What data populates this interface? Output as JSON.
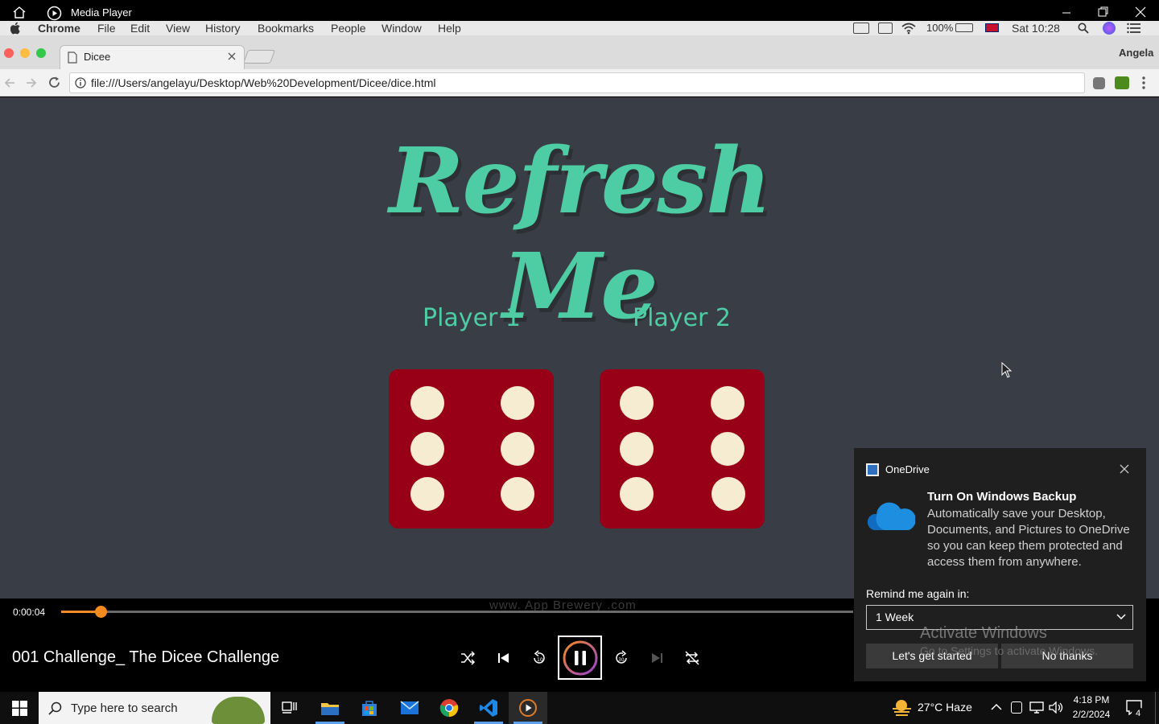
{
  "media_player": {
    "app_title": "Media Player",
    "current_time": "0:00:04",
    "progress_fraction": 0.05,
    "track_title": "001 Challenge_ The Dicee Challenge"
  },
  "mac_menu": {
    "app_name": "Chrome",
    "items": [
      "File",
      "Edit",
      "View",
      "History",
      "Bookmarks",
      "People",
      "Window",
      "Help"
    ],
    "battery": "100%",
    "clock": "Sat 10:28"
  },
  "browser": {
    "tab_title": "Dicee",
    "profile": "Angela",
    "url": "file:///Users/angelayu/Desktop/Web%20Development/Dicee/dice.html"
  },
  "page": {
    "title": "Refresh Me",
    "player1": "Player 1",
    "player2": "Player 2",
    "die1_value": 6,
    "die2_value": 6,
    "watermark": "www.  App Brewery  .com"
  },
  "onedrive": {
    "app": "OneDrive",
    "heading": "Turn On Windows Backup",
    "body": "Automatically save your Desktop, Documents, and Pictures to OneDrive so you can keep them protected and access them from anywhere.",
    "remind_label": "Remind me again in:",
    "remind_value": "1 Week",
    "primary_button": "Let's get started",
    "secondary_button": "No thanks",
    "activate_title": "Activate Windows",
    "activate_sub": "Go to Settings to activate Windows."
  },
  "taskbar": {
    "search_placeholder": "Type here to search",
    "weather": "27°C  Haze",
    "time": "4:18 PM",
    "date": "2/2/2024",
    "notifications": "4"
  },
  "colors": {
    "accent_green": "#4ecca3",
    "page_bg": "#393e46",
    "die_red": "#970017",
    "pip": "#f6ecd2",
    "progress_orange": "#f68b1f"
  }
}
